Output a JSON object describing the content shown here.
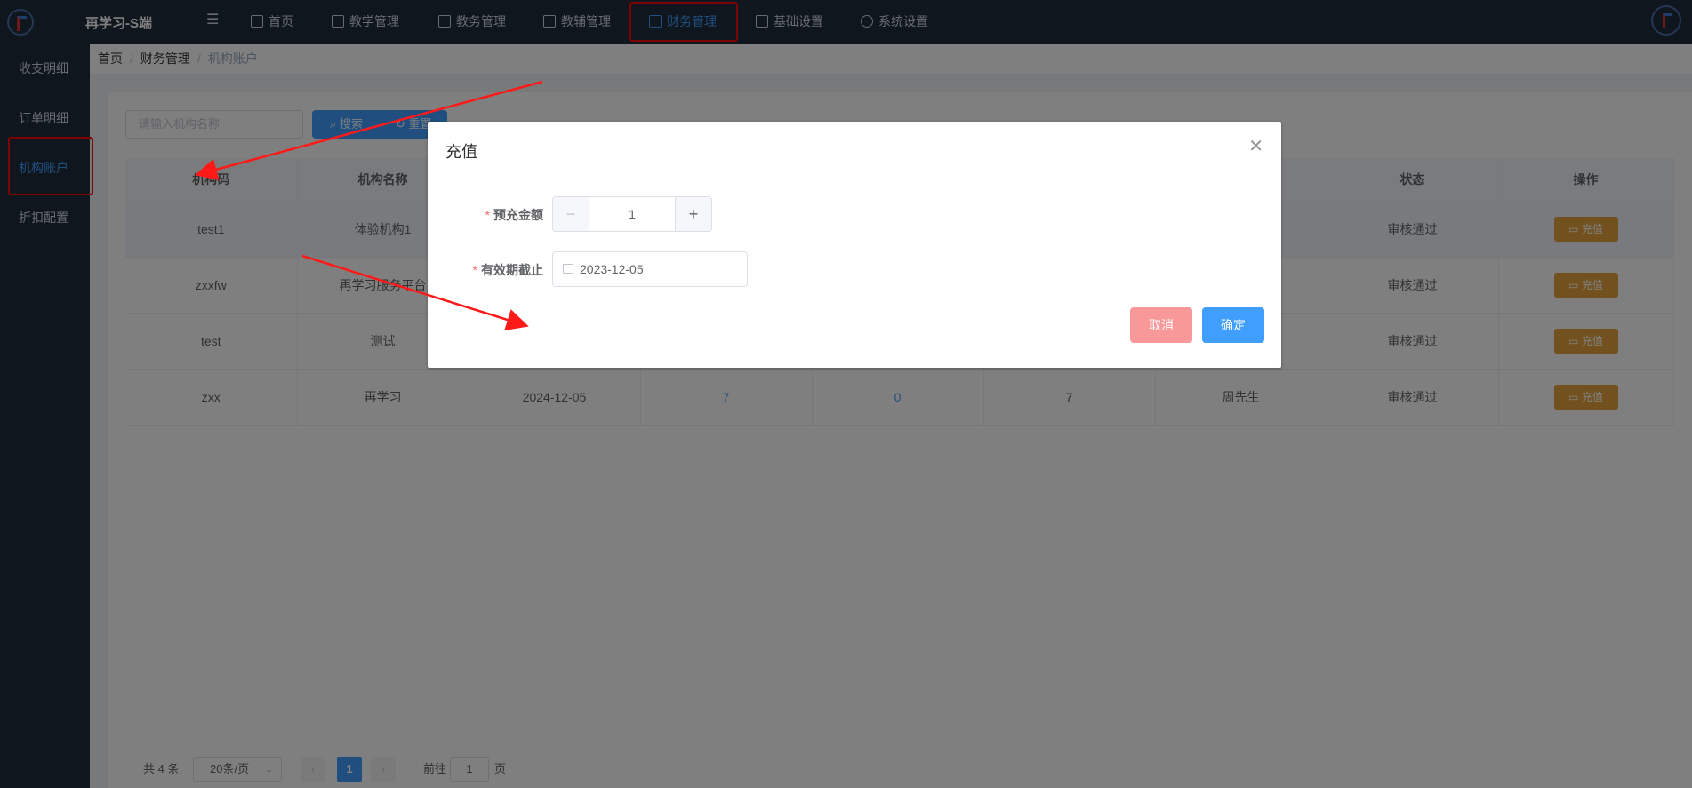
{
  "app": {
    "title": "再学习-S端"
  },
  "topnav": [
    {
      "label": "首页",
      "icon": "home-icon"
    },
    {
      "label": "教学管理",
      "icon": "book-icon"
    },
    {
      "label": "教务管理",
      "icon": "document-icon"
    },
    {
      "label": "教辅管理",
      "icon": "notebook-icon"
    },
    {
      "label": "财务管理",
      "icon": "wallet-icon",
      "active": true
    },
    {
      "label": "基础设置",
      "icon": "document-icon"
    },
    {
      "label": "系统设置",
      "icon": "gear-icon"
    }
  ],
  "sidebar": {
    "items": [
      {
        "label": "收支明细"
      },
      {
        "label": "订单明细"
      },
      {
        "label": "机构账户",
        "active": true
      },
      {
        "label": "折扣配置"
      }
    ]
  },
  "breadcrumb": [
    "首页",
    "财务管理",
    "机构账户"
  ],
  "filters": {
    "search_placeholder": "请输入机构名称",
    "search_label": "搜索",
    "reset_label": "重置"
  },
  "table": {
    "columns": [
      "机构码",
      "机构名称",
      "",
      "",
      "",
      "",
      "",
      "状态",
      "操作"
    ],
    "action_label": "充值",
    "rows": [
      {
        "code": "test1",
        "name": "体验机构1",
        "status": "审核通过"
      },
      {
        "code": "zxxfw",
        "name": "再学习服务平台",
        "status": "审核通过"
      },
      {
        "code": "test",
        "name": "测试",
        "status": "审核通过"
      },
      {
        "code": "zxx",
        "name": "再学习",
        "expire": "2024-12-05",
        "v1": "7",
        "v2": "0",
        "v3": "7",
        "contact": "周先生",
        "status": "审核通过"
      }
    ]
  },
  "pagination": {
    "total": "共 4 条",
    "page_size": "20条/页",
    "current_page": "1",
    "goto_prefix": "前往",
    "goto_value": "1",
    "goto_suffix": "页"
  },
  "dialog": {
    "title": "充值",
    "amount_label": "预充金额",
    "amount_value": "1",
    "expire_label": "有效期截止",
    "expire_value": "2023-12-05",
    "cancel_label": "取消",
    "confirm_label": "确定"
  },
  "colors": {
    "primary": "#409eff",
    "warning": "#e6a23c",
    "sidebar_bg": "#1f2d3d",
    "annotation": "#ff0000"
  }
}
